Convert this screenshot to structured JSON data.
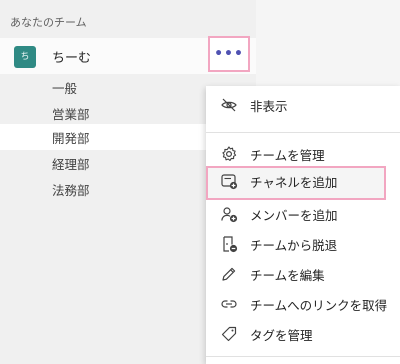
{
  "sidebar": {
    "section_header": "あなたのチーム",
    "team": {
      "avatar_initial": "ち",
      "name": "ちーむ",
      "more_label": "•••",
      "avatar_color": "#2f8a84"
    },
    "channels": [
      {
        "label": "一般",
        "selected": false
      },
      {
        "label": "営業部",
        "selected": false
      },
      {
        "label": "開発部",
        "selected": true
      },
      {
        "label": "経理部",
        "selected": false
      },
      {
        "label": "法務部",
        "selected": false
      }
    ]
  },
  "context_menu": {
    "items": [
      {
        "label": "非表示",
        "icon": "hide-icon"
      },
      {
        "label": "チームを管理",
        "icon": "gear-icon"
      },
      {
        "label": "チャネルを追加",
        "icon": "add-channel-icon",
        "highlighted": true
      },
      {
        "label": "メンバーを追加",
        "icon": "add-member-icon"
      },
      {
        "label": "チームから脱退",
        "icon": "leave-team-icon"
      },
      {
        "label": "チームを編集",
        "icon": "edit-pencil-icon"
      },
      {
        "label": "チームへのリンクを取得",
        "icon": "link-icon"
      },
      {
        "label": "タグを管理",
        "icon": "tag-icon"
      }
    ]
  },
  "colors": {
    "highlight_border": "#f2a6c1",
    "accent": "#4f52b2"
  }
}
